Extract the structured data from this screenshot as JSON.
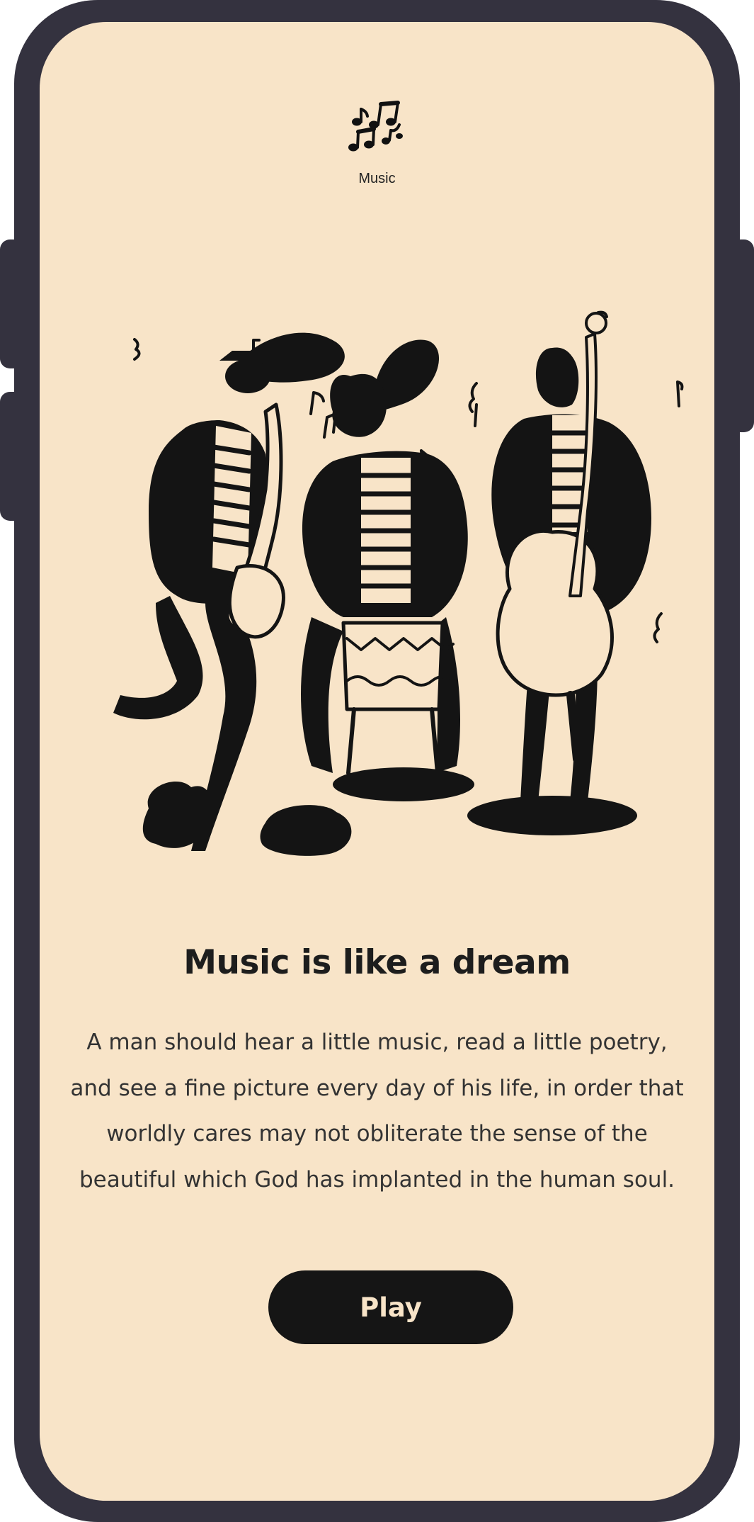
{
  "app": {
    "icon": "music-notes-icon",
    "label": "Music"
  },
  "hero": {
    "illustration": "jazz-trio-illustration"
  },
  "content": {
    "title": "Music is like a dream",
    "quote": "A man should hear a little music, read a little poetry, and see a fine picture every day of his life, in order that worldly cares may not obliterate the sense of the beautiful which God has implanted in the human soul."
  },
  "actions": {
    "play_label": "Play"
  },
  "colors": {
    "frame": "#34323f",
    "screen": "#f8e4c8",
    "ink": "#151515"
  }
}
